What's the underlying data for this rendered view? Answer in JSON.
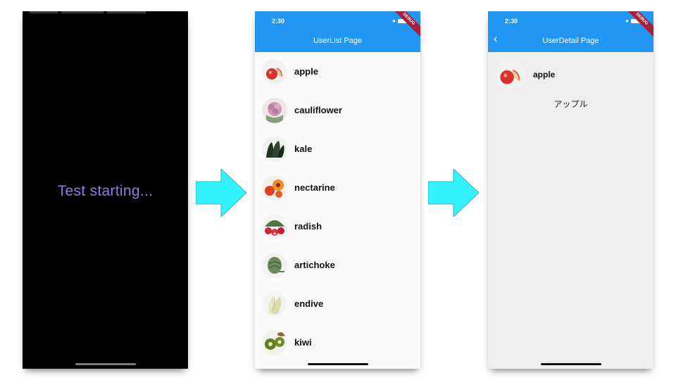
{
  "screen1": {
    "message": "Test starting..."
  },
  "screen2": {
    "time": "2:30",
    "title": "UserList Page",
    "debug": "DEBUG",
    "items": [
      {
        "label": "apple",
        "icon": "apple-icon"
      },
      {
        "label": "cauliflower",
        "icon": "cauliflower-icon"
      },
      {
        "label": "kale",
        "icon": "kale-icon"
      },
      {
        "label": "nectarine",
        "icon": "nectarine-icon"
      },
      {
        "label": "radish",
        "icon": "radish-icon"
      },
      {
        "label": "artichoke",
        "icon": "artichoke-icon"
      },
      {
        "label": "endive",
        "icon": "endive-icon"
      },
      {
        "label": "kiwi",
        "icon": "kiwi-icon"
      }
    ]
  },
  "screen3": {
    "time": "2:30",
    "title": "UserDetail Page",
    "debug": "DEBUG",
    "name": "apple",
    "reading": "アップル"
  },
  "colors": {
    "appbar": "#2196f3",
    "arrow": "#33f3ff",
    "test_text": "#8b7fe0",
    "debug_banner": "#a8203a"
  }
}
